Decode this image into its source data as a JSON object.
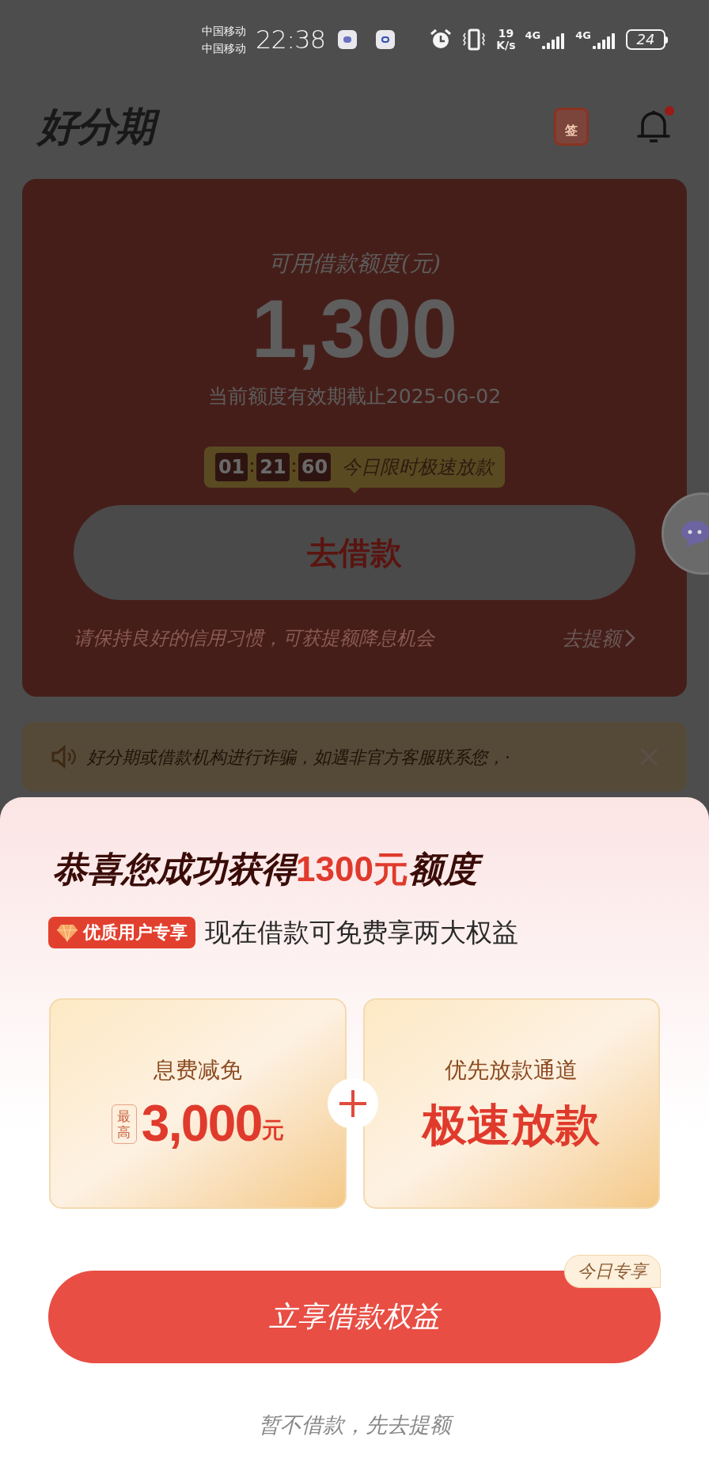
{
  "status_bar": {
    "carriers": [
      "中国移动",
      "中国移动"
    ],
    "time": "22:38",
    "net_speed": "19",
    "net_unit": "K/s",
    "networks": [
      "4G",
      "4G"
    ],
    "battery": "24"
  },
  "header": {
    "logo": "好分期",
    "checkin_label": "签",
    "unread": true
  },
  "credit_card": {
    "label": "可用借款额度(元)",
    "amount": "1,300",
    "expiry": "当前额度有效期截止2025-06-02",
    "timer": {
      "parts": [
        "01",
        "21",
        "60"
      ],
      "text": "今日限时极速放款"
    },
    "button": "去借款",
    "footer_text": "请保持良好的信用习惯，可获提额降息机会",
    "footer_link": "去提额"
  },
  "notice": {
    "text": "好分期或借款机构进行诈骗，如遇非官方客服联系您，·"
  },
  "sheet": {
    "title_before": "恭喜您成功获得",
    "title_highlight": "1300元",
    "title_after": "额度",
    "badge": "优质用户专享",
    "subtitle": "现在借款可免费享两大权益",
    "benefits": [
      {
        "kind": "amount",
        "title": "息费减免",
        "prefix": "最高",
        "value": "3,000",
        "unit": "元"
      },
      {
        "kind": "text",
        "title": "优先放款通道",
        "value": "极速放款"
      }
    ],
    "cta": "立享借款权益",
    "cta_tag": "今日专享",
    "secondary": "暂不借款，先去提额"
  }
}
